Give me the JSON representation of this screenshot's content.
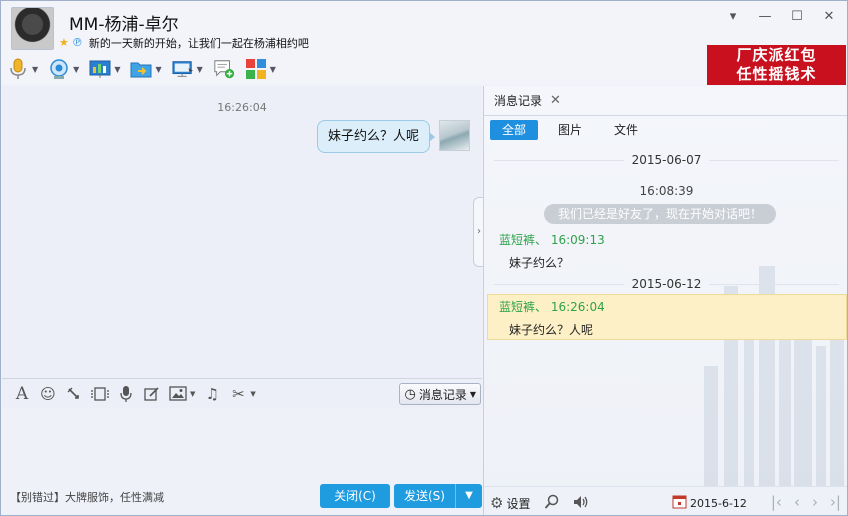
{
  "header": {
    "contact_name": "MM-杨浦-卓尔",
    "signature": "新的一天新的开始，让我们一起在杨浦相约吧",
    "ad_banner_line1": "厂庆派红包",
    "ad_banner_line2": "任性摇钱术"
  },
  "chat": {
    "timestamp": "16:26:04",
    "message": "妹子约么？人呢"
  },
  "compose": {
    "history_button": "消息记录",
    "ad_text": "【别错过】大牌服饰，任性满减",
    "close_button": "关闭(C)",
    "send_button": "发送(S)"
  },
  "history": {
    "tab_label": "消息记录",
    "filters": [
      "全部",
      "图片",
      "文件"
    ],
    "date1": "2015-06-07",
    "time1": "16:08:39",
    "system_notice": "我们已经是好友了，现在开始对话吧！",
    "msg1_head": "蓝短裤、 16:09:13",
    "msg1_body": "妹子约么？",
    "date2": "2015-06-12",
    "msg2_head": "蓝短裤、 16:26:04",
    "msg2_body": "妹子约么？人呢",
    "settings_label": "设置",
    "footer_date": "2015-6-12"
  },
  "colors": {
    "accent": "#1f9be0",
    "ad_red": "#c9101e",
    "sender_green": "#2ea24b",
    "highlight": "#fdf0c6"
  }
}
